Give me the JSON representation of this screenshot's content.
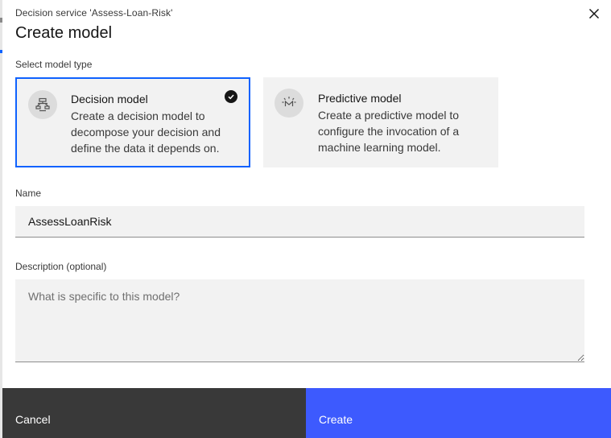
{
  "modal": {
    "supertitle": "Decision service 'Assess-Loan-Risk'",
    "title": "Create model"
  },
  "model_type": {
    "label": "Select model type",
    "options": [
      {
        "title": "Decision model",
        "description": "Create a decision model to decompose your decision and define the data it depends on.",
        "icon": "decision-model-icon",
        "selected": true
      },
      {
        "title": "Predictive model",
        "description": "Create a predictive model to configure the invocation of a machine learning model.",
        "icon": "predictive-model-icon",
        "selected": false
      }
    ]
  },
  "name": {
    "label": "Name",
    "value": "AssessLoanRisk"
  },
  "description": {
    "label": "Description (optional)",
    "placeholder": "What is specific to this model?",
    "value": ""
  },
  "footer": {
    "cancel_label": "Cancel",
    "create_label": "Create"
  },
  "colors": {
    "primary": "#3d5afe",
    "secondary": "#393939",
    "selected_border": "#0f62fe",
    "tile_bg": "#f2f2f2"
  }
}
